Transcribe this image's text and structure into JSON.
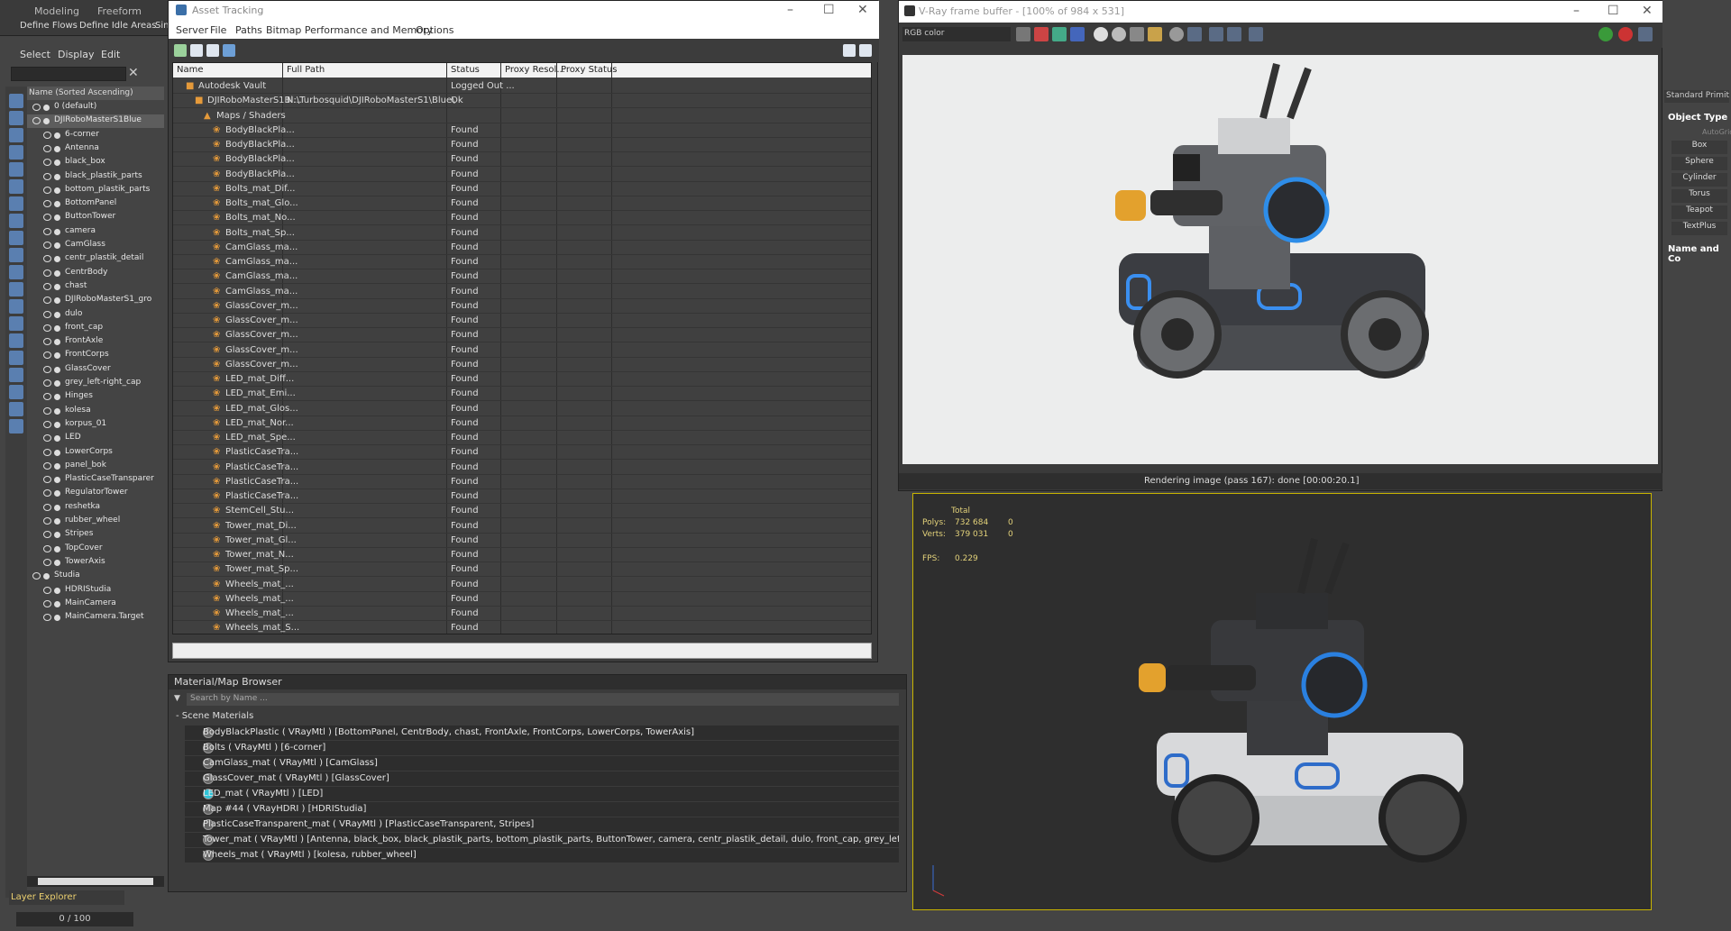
{
  "ribbon": {
    "tabs": [
      "Modeling",
      "Freeform"
    ],
    "buttons": [
      "Define Flows",
      "Define Idle Areas",
      "Sin"
    ]
  },
  "explorer_menu": [
    "Select",
    "Display",
    "Edit"
  ],
  "scene_tree": {
    "header": "Name (Sorted Ascending)",
    "items": [
      {
        "label": "0 (default)",
        "depth": 1
      },
      {
        "label": "DJIRoboMasterS1Blue",
        "depth": 1,
        "selected": true
      },
      {
        "label": "6-corner",
        "depth": 2
      },
      {
        "label": "Antenna",
        "depth": 2
      },
      {
        "label": "black_box",
        "depth": 2
      },
      {
        "label": "black_plastik_parts",
        "depth": 2
      },
      {
        "label": "bottom_plastik_parts",
        "depth": 2
      },
      {
        "label": "BottomPanel",
        "depth": 2
      },
      {
        "label": "ButtonTower",
        "depth": 2
      },
      {
        "label": "camera",
        "depth": 2
      },
      {
        "label": "CamGlass",
        "depth": 2
      },
      {
        "label": "centr_plastik_detail",
        "depth": 2
      },
      {
        "label": "CentrBody",
        "depth": 2
      },
      {
        "label": "chast",
        "depth": 2
      },
      {
        "label": "DJIRoboMasterS1_gro",
        "depth": 2
      },
      {
        "label": "dulo",
        "depth": 2
      },
      {
        "label": "front_cap",
        "depth": 2
      },
      {
        "label": "FrontAxle",
        "depth": 2
      },
      {
        "label": "FrontCorps",
        "depth": 2
      },
      {
        "label": "GlassCover",
        "depth": 2
      },
      {
        "label": "grey_left-right_cap",
        "depth": 2
      },
      {
        "label": "Hinges",
        "depth": 2
      },
      {
        "label": "kolesa",
        "depth": 2
      },
      {
        "label": "korpus_01",
        "depth": 2
      },
      {
        "label": "LED",
        "depth": 2
      },
      {
        "label": "LowerCorps",
        "depth": 2
      },
      {
        "label": "panel_bok",
        "depth": 2
      },
      {
        "label": "PlasticCaseTransparer",
        "depth": 2
      },
      {
        "label": "RegulatorTower",
        "depth": 2
      },
      {
        "label": "reshetka",
        "depth": 2
      },
      {
        "label": "rubber_wheel",
        "depth": 2
      },
      {
        "label": "Stripes",
        "depth": 2
      },
      {
        "label": "TopCover",
        "depth": 2
      },
      {
        "label": "TowerAxis",
        "depth": 2
      },
      {
        "label": "Studia",
        "depth": 1
      },
      {
        "label": "HDRIStudia",
        "depth": 2
      },
      {
        "label": "MainCamera",
        "depth": 2
      },
      {
        "label": "MainCamera.Target",
        "depth": 2
      }
    ]
  },
  "layer_explorer": "Layer Explorer",
  "timeline_pager": "0 / 100",
  "asset_window": {
    "title": "Asset Tracking",
    "menu": [
      "Server",
      "File",
      "Paths",
      "Bitmap Performance and Memory",
      "Options"
    ],
    "columns": [
      "Name",
      "Full Path",
      "Status",
      "Proxy Resol...",
      "Proxy Status"
    ],
    "rows": [
      {
        "name": "Autodesk Vault",
        "path": "",
        "status": "Logged Out ...",
        "indent": 0
      },
      {
        "name": "DJIRoboMasterS1Bl...",
        "path": "N:\\Turbosquid\\DJIRoboMasterS1\\Blue\\",
        "status": "Ok",
        "indent": 1
      },
      {
        "name": "Maps / Shaders",
        "path": "",
        "status": "",
        "indent": 2
      },
      {
        "name": "BodyBlackPla...",
        "path": "",
        "status": "Found",
        "indent": 3
      },
      {
        "name": "BodyBlackPla...",
        "path": "",
        "status": "Found",
        "indent": 3
      },
      {
        "name": "BodyBlackPla...",
        "path": "",
        "status": "Found",
        "indent": 3
      },
      {
        "name": "BodyBlackPla...",
        "path": "",
        "status": "Found",
        "indent": 3
      },
      {
        "name": "Bolts_mat_Dif...",
        "path": "",
        "status": "Found",
        "indent": 3
      },
      {
        "name": "Bolts_mat_Glo...",
        "path": "",
        "status": "Found",
        "indent": 3
      },
      {
        "name": "Bolts_mat_No...",
        "path": "",
        "status": "Found",
        "indent": 3
      },
      {
        "name": "Bolts_mat_Sp...",
        "path": "",
        "status": "Found",
        "indent": 3
      },
      {
        "name": "CamGlass_ma...",
        "path": "",
        "status": "Found",
        "indent": 3
      },
      {
        "name": "CamGlass_ma...",
        "path": "",
        "status": "Found",
        "indent": 3
      },
      {
        "name": "CamGlass_ma...",
        "path": "",
        "status": "Found",
        "indent": 3
      },
      {
        "name": "CamGlass_ma...",
        "path": "",
        "status": "Found",
        "indent": 3
      },
      {
        "name": "GlassCover_m...",
        "path": "",
        "status": "Found",
        "indent": 3
      },
      {
        "name": "GlassCover_m...",
        "path": "",
        "status": "Found",
        "indent": 3
      },
      {
        "name": "GlassCover_m...",
        "path": "",
        "status": "Found",
        "indent": 3
      },
      {
        "name": "GlassCover_m...",
        "path": "",
        "status": "Found",
        "indent": 3
      },
      {
        "name": "GlassCover_m...",
        "path": "",
        "status": "Found",
        "indent": 3
      },
      {
        "name": "LED_mat_Diff...",
        "path": "",
        "status": "Found",
        "indent": 3
      },
      {
        "name": "LED_mat_Emi...",
        "path": "",
        "status": "Found",
        "indent": 3
      },
      {
        "name": "LED_mat_Glos...",
        "path": "",
        "status": "Found",
        "indent": 3
      },
      {
        "name": "LED_mat_Nor...",
        "path": "",
        "status": "Found",
        "indent": 3
      },
      {
        "name": "LED_mat_Spe...",
        "path": "",
        "status": "Found",
        "indent": 3
      },
      {
        "name": "PlasticCaseTra...",
        "path": "",
        "status": "Found",
        "indent": 3
      },
      {
        "name": "PlasticCaseTra...",
        "path": "",
        "status": "Found",
        "indent": 3
      },
      {
        "name": "PlasticCaseTra...",
        "path": "",
        "status": "Found",
        "indent": 3
      },
      {
        "name": "PlasticCaseTra...",
        "path": "",
        "status": "Found",
        "indent": 3
      },
      {
        "name": "StemCell_Stu...",
        "path": "",
        "status": "Found",
        "indent": 3
      },
      {
        "name": "Tower_mat_Di...",
        "path": "",
        "status": "Found",
        "indent": 3
      },
      {
        "name": "Tower_mat_Gl...",
        "path": "",
        "status": "Found",
        "indent": 3
      },
      {
        "name": "Tower_mat_N...",
        "path": "",
        "status": "Found",
        "indent": 3
      },
      {
        "name": "Tower_mat_Sp...",
        "path": "",
        "status": "Found",
        "indent": 3
      },
      {
        "name": "Wheels_mat_...",
        "path": "",
        "status": "Found",
        "indent": 3
      },
      {
        "name": "Wheels_mat_...",
        "path": "",
        "status": "Found",
        "indent": 3
      },
      {
        "name": "Wheels_mat_...",
        "path": "",
        "status": "Found",
        "indent": 3
      },
      {
        "name": "Wheels_mat_S...",
        "path": "",
        "status": "Found",
        "indent": 3
      }
    ]
  },
  "material_browser": {
    "title": "Material/Map Browser",
    "search_placeholder": "Search by Name ...",
    "section": "Scene Materials",
    "items": [
      "BodyBlackPlastic  ( VRayMtl ) [BottomPanel, CentrBody, chast, FrontAxle, FrontCorps, LowerCorps, TowerAxis]",
      "Bolts  ( VRayMtl ) [6-corner]",
      "CamGlass_mat  ( VRayMtl ) [CamGlass]",
      "GlassCover_mat  ( VRayMtl ) [GlassCover]",
      "LED_mat  ( VRayMtl ) [LED]",
      "Map #44  ( VRayHDRI ) [HDRIStudia]",
      "PlasticCaseTransparent_mat  ( VRayMtl ) [PlasticCaseTransparent, Stripes]",
      "Tower_mat  ( VRayMtl ) [Antenna, black_box, black_plastik_parts, bottom_plastik_parts, ButtonTower, camera, centr_plastik_detail, dulo, front_cap, grey_left-right_cap, Hinges...",
      "Wheels_mat  ( VRayMtl ) [kolesa, rubber_wheel]"
    ]
  },
  "vray": {
    "title": "V-Ray frame buffer - [100% of 984 x 531]",
    "channel": "RGB color",
    "status": "Rendering image (pass 167): done [00:00:20.1]"
  },
  "viewport_stats": {
    "total": "Total",
    "polys_label": "Polys:",
    "polys": "732 684",
    "polys_sel": "0",
    "verts_label": "Verts:",
    "verts": "379 031",
    "verts_sel": "0",
    "fps_label": "FPS:",
    "fps": "0.229"
  },
  "right_panel": {
    "dropdown": "Standard Primitives",
    "object_type": "Object Type",
    "autogrid": "AutoGrid",
    "buttons": [
      "Box",
      "Sphere",
      "Cylinder",
      "Torus",
      "Teapot",
      "TextPlus"
    ],
    "name_and_color": "Name and Co"
  },
  "colors": {
    "accent_blue": "#5a7fb0",
    "found_icon": "#e59a3a",
    "viewport_border": "#c8b400"
  }
}
